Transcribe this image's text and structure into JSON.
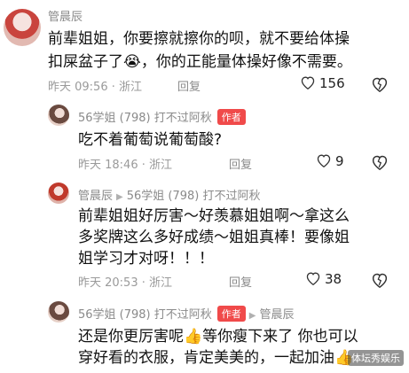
{
  "comments": [
    {
      "name": "管晨辰",
      "lines": [
        "前辈姐姐，你要擦就擦你的呗，就不要给体操",
        "扣屎盆子了😭，你的正能量体操好像不需要。"
      ],
      "time": "昨天 09:56 · 浙江",
      "reply": "回复",
      "likes": "156"
    },
    {
      "name": "56学姐 (798) 打不过阿秋",
      "badge": "作者",
      "lines": [
        "吃不着葡萄说葡萄酸?"
      ],
      "time": "昨天 18:46 · 浙江",
      "reply": "回复",
      "likes": "9"
    },
    {
      "name": "管晨辰",
      "reply_to": "56学姐 (798) 打不过阿秋",
      "lines": [
        "前辈姐姐好厉害～好羡慕姐姐啊～拿这么",
        "多奖牌这么多好成绩～姐姐真棒！要像姐",
        "姐学习才对呀！！！"
      ],
      "time": "昨天 20:53 · 浙江",
      "reply": "回复",
      "likes": "38"
    },
    {
      "name": "56学姐 (798) 打不过阿秋",
      "badge": "作者",
      "reply_to": "管晨辰",
      "lines": [
        "还是你更厉害呢👍等你瘦下来了 你也可以",
        "穿好看的衣服，肯定美美的，一起加油👍"
      ]
    }
  ],
  "watermark": "体坛秀娱乐"
}
